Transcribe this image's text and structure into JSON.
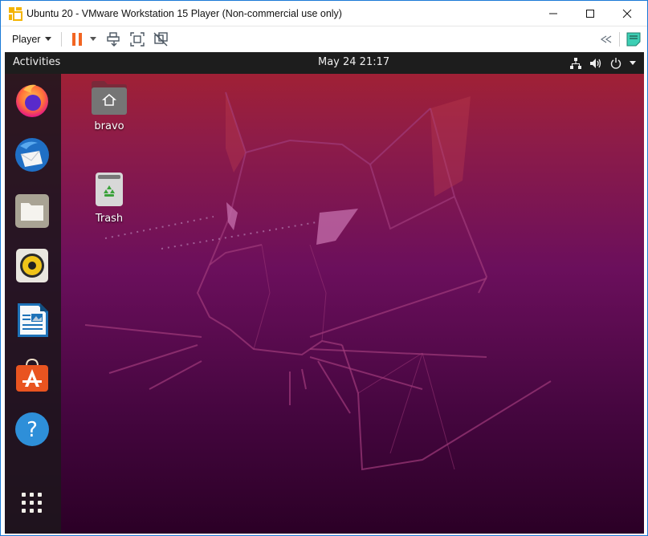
{
  "window": {
    "title": "Ubuntu 20 - VMware Workstation 15 Player (Non-commercial use only)",
    "app_icon": "vmware-player-icon",
    "controls": [
      "minimize-icon",
      "maximize-icon",
      "close-icon"
    ]
  },
  "toolbar": {
    "player_label": "Player",
    "icons": [
      "pause-icon",
      "power-dropdown-icon",
      "send-ctrl-alt-del-icon",
      "full-screen-icon",
      "unity-icon"
    ],
    "right_icons": [
      "collapse-toolbar-icon",
      "message-log-icon"
    ]
  },
  "guest": {
    "topbar": {
      "activities_label": "Activities",
      "clock": "May 24  21:17",
      "tray_icons": [
        "network-icon",
        "volume-icon",
        "power-icon",
        "system-menu-caret-icon"
      ]
    },
    "dock": {
      "items": [
        {
          "name": "Firefox",
          "icon": "firefox-icon"
        },
        {
          "name": "Thunderbird Mail",
          "icon": "thunderbird-icon"
        },
        {
          "name": "Files",
          "icon": "files-icon"
        },
        {
          "name": "Rhythmbox",
          "icon": "rhythmbox-icon"
        },
        {
          "name": "LibreOffice Writer",
          "icon": "libreoffice-writer-icon"
        },
        {
          "name": "Ubuntu Software",
          "icon": "ubuntu-software-icon"
        },
        {
          "name": "Help",
          "icon": "help-icon"
        }
      ],
      "show_apps_icon": "show-applications-icon"
    },
    "desktop": {
      "icons": [
        {
          "label": "bravo",
          "icon": "home-folder-icon"
        },
        {
          "label": "Trash",
          "icon": "trash-icon"
        }
      ]
    },
    "colors": {
      "wallpaper_top": "#a6222f",
      "wallpaper_mid": "#6b0f5c",
      "wallpaper_bottom": "#2b0026",
      "panel": "#1d1d1d",
      "vmware_accent": "#f26522",
      "window_border": "#1a79d6"
    }
  }
}
